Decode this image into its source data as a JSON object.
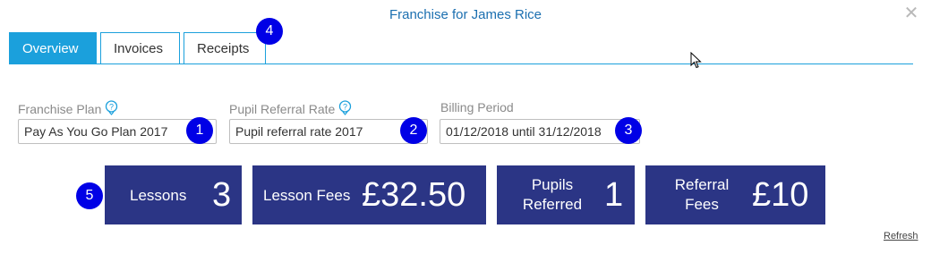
{
  "dialog": {
    "title": "Franchise for James Rice",
    "close_icon": "close-icon"
  },
  "tabs": [
    {
      "label": "Overview",
      "active": true
    },
    {
      "label": "Invoices",
      "active": false
    },
    {
      "label": "Receipts",
      "active": false
    }
  ],
  "fields": {
    "franchise_plan": {
      "label": "Franchise Plan",
      "value": "Pay As You Go Plan 2017"
    },
    "pupil_referral_rate": {
      "label": "Pupil Referral Rate",
      "value": "Pupil referral rate 2017"
    },
    "billing_period": {
      "label": "Billing Period",
      "value": "01/12/2018 until 31/12/2018"
    }
  },
  "stats": {
    "lessons": {
      "label": "Lessons",
      "value": "3"
    },
    "lesson_fees": {
      "label": "Lesson Fees",
      "value": "£32.50"
    },
    "pupils_referred": {
      "label_line1": "Pupils",
      "label_line2": "Referred",
      "value": "1"
    },
    "referral_fees": {
      "label_line1": "Referral",
      "label_line2": "Fees",
      "value": "£10"
    }
  },
  "markers": [
    "1",
    "2",
    "3",
    "4",
    "5"
  ],
  "refresh_label": "Refresh",
  "colors": {
    "accent": "#1ba0dc",
    "title": "#1b6fb0",
    "stat_bg": "#2b3585",
    "marker": "#0000e6"
  }
}
